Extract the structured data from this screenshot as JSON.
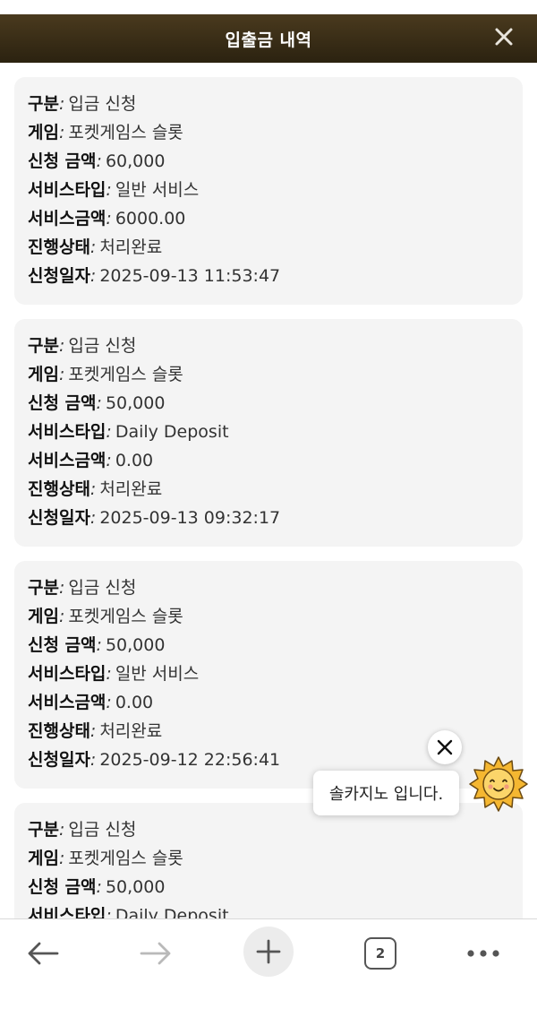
{
  "header": {
    "title": "입출금 내역",
    "close_icon": "close-icon"
  },
  "records": [
    {
      "type_label": "구분",
      "type_value": "입금 신청",
      "game_label": "게임",
      "game_value": "포켓게임스 슬롯",
      "amount_label": "신청 금액",
      "amount_value": "60,000",
      "service_type_label": "서비스타입",
      "service_type_value": "일반 서비스",
      "service_amount_label": "서비스금액",
      "service_amount_value": "6000.00",
      "status_label": "진행상태",
      "status_value": "처리완료",
      "date_label": "신청일자",
      "date_value": "2025-09-13 11:53:47"
    },
    {
      "type_label": "구분",
      "type_value": "입금 신청",
      "game_label": "게임",
      "game_value": "포켓게임스 슬롯",
      "amount_label": "신청 금액",
      "amount_value": "50,000",
      "service_type_label": "서비스타입",
      "service_type_value": "Daily Deposit",
      "service_amount_label": "서비스금액",
      "service_amount_value": "0.00",
      "status_label": "진행상태",
      "status_value": "처리완료",
      "date_label": "신청일자",
      "date_value": "2025-09-13 09:32:17"
    },
    {
      "type_label": "구분",
      "type_value": "입금 신청",
      "game_label": "게임",
      "game_value": "포켓게임스 슬롯",
      "amount_label": "신청 금액",
      "amount_value": "50,000",
      "service_type_label": "서비스타입",
      "service_type_value": "일반 서비스",
      "service_amount_label": "서비스금액",
      "service_amount_value": "0.00",
      "status_label": "진행상태",
      "status_value": "처리완료",
      "date_label": "신청일자",
      "date_value": "2025-09-12 22:56:41"
    },
    {
      "type_label": "구분",
      "type_value": "입금 신청",
      "game_label": "게임",
      "game_value": "포켓게임스 슬롯",
      "amount_label": "신청 금액",
      "amount_value": "50,000",
      "service_type_label": "서비스타입",
      "service_type_value": "Daily Deposit",
      "service_amount_label": "",
      "service_amount_value": "",
      "status_label": "",
      "status_value": "",
      "date_label": "",
      "date_value": ""
    }
  ],
  "separator": ":",
  "chat": {
    "message": "솔카지노 입니다.",
    "avatar_icon": "sun-face-icon",
    "close_icon": "close-icon"
  },
  "toolbar": {
    "back_icon": "arrow-left-icon",
    "forward_icon": "arrow-right-icon",
    "new_tab_icon": "plus-icon",
    "tab_count": "2",
    "more_icon": "more-dots-icon"
  },
  "colors": {
    "header_bg": "#3b2f18",
    "card_bg": "#f4f4f4",
    "text": "#222222"
  }
}
